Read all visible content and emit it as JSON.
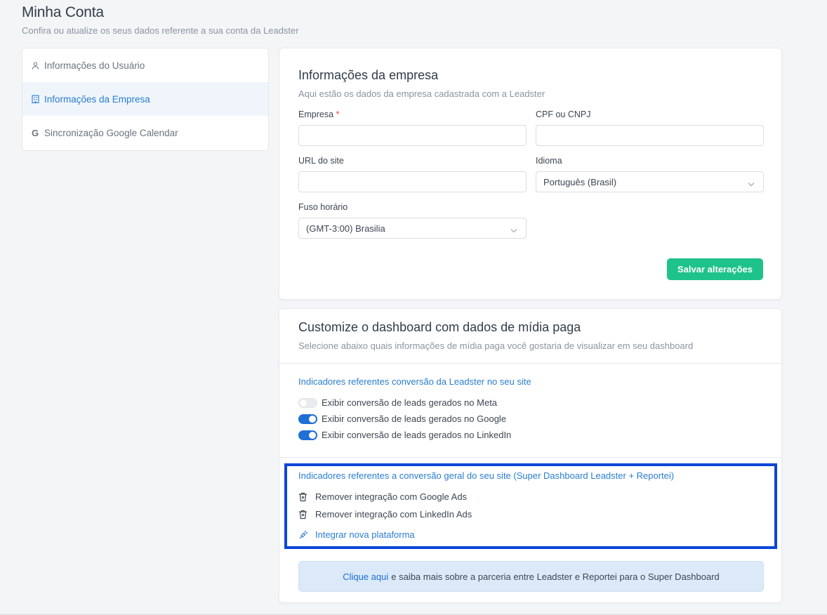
{
  "header": {
    "title": "Minha Conta",
    "subtitle": "Confira ou atualize os seus dados referente a sua conta da Leadster"
  },
  "sidebar": {
    "items": [
      {
        "label": "Informações do Usuário",
        "icon": "user-icon",
        "active": false
      },
      {
        "label": "Informações da Empresa",
        "icon": "building-icon",
        "active": true
      },
      {
        "label": "Sincronização Google Calendar",
        "icon": "google-icon",
        "active": false
      }
    ],
    "google_glyph": "G"
  },
  "company": {
    "title": "Informações da empresa",
    "subtitle": "Aqui estão os dados da empresa cadastrada com a Leadster",
    "empresa_label": "Empresa",
    "required_mark": "*",
    "empresa_value": "",
    "cpf_label": "CPF ou CNPJ",
    "cpf_value": "",
    "url_label": "URL do site",
    "url_value": "",
    "idioma_label": "Idioma",
    "idioma_value": "Português (Brasil)",
    "fuso_label": "Fuso horário",
    "fuso_value": "(GMT-3:00) Brasilia",
    "save_label": "Salvar alterações"
  },
  "dashboard": {
    "title": "Customize o dashboard com dados de mídia paga",
    "subtitle": "Selecione abaixo quais informações de mídia paga você gostaria de visualizar em seu dashboard",
    "section1_title": "Indicadores referentes conversão da Leadster no seu site",
    "toggles": [
      {
        "label": "Exibir conversão de leads gerados no Meta",
        "on": false
      },
      {
        "label": "Exibir conversão de leads gerados no Google",
        "on": true
      },
      {
        "label": "Exibir conversão de leads gerados no LinkedIn",
        "on": true
      }
    ],
    "section2_title": "Indicadores referentes a conversão geral do seu site (Super Dashboard Leadster + Reportei)",
    "actions": [
      {
        "label": "Remover integração com Google Ads",
        "icon": "trash-icon"
      },
      {
        "label": "Remover integração com LinkedIn Ads",
        "icon": "trash-icon"
      }
    ],
    "integrate_label": "Integrar nova plataforma",
    "info_link": "Clique aqui",
    "info_text": "e saiba mais sobre a parceria entre Leadster e Reportei para o Super Dashboard"
  },
  "colors": {
    "accent": "#2a7dd1",
    "save_button": "#1ec28b",
    "toggle_on": "#1f6fd6",
    "highlight_border": "#0a46d8",
    "info_bg": "#dbe9f8"
  }
}
